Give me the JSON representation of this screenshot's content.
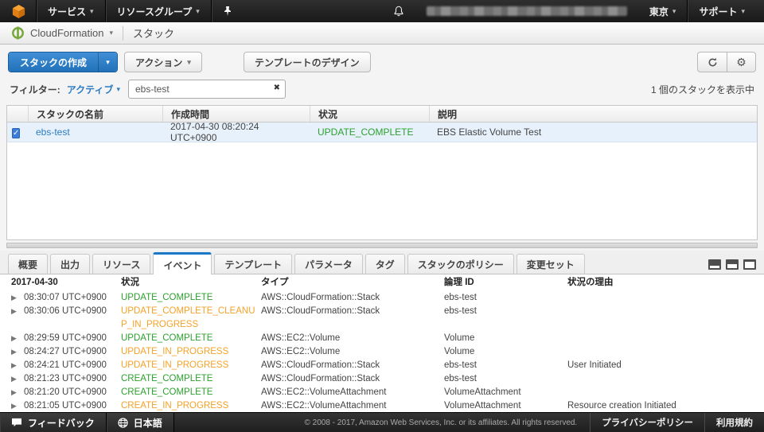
{
  "topnav": {
    "services_label": "サービス",
    "resource_groups_label": "リソースグループ",
    "region_label": "東京",
    "support_label": "サポート"
  },
  "servicebar": {
    "service_name": "CloudFormation",
    "breadcrumb": "スタック"
  },
  "toolbar": {
    "create_stack_label": "スタックの作成",
    "actions_label": "アクション",
    "design_template_label": "テンプレートのデザイン"
  },
  "filter": {
    "label": "フィルター:",
    "status_filter": "アクティブ",
    "search_value": "ebs-test",
    "count_text": "1 個のスタックを表示中"
  },
  "stacks_table": {
    "headers": [
      "スタックの名前",
      "作成時間",
      "状況",
      "説明"
    ],
    "rows": [
      {
        "checked": true,
        "name": "ebs-test",
        "created": "2017-04-30 08:20:24 UTC+0900",
        "status": "UPDATE_COMPLETE",
        "status_color": "green",
        "description": "EBS Elastic Volume Test"
      }
    ]
  },
  "tabs": [
    "概要",
    "出力",
    "リソース",
    "イベント",
    "テンプレート",
    "パラメータ",
    "タグ",
    "スタックのポリシー",
    "変更セット"
  ],
  "active_tab": "イベント",
  "events_table": {
    "date_header": "2017-04-30",
    "headers": [
      "状況",
      "タイプ",
      "論理 ID",
      "状況の理由"
    ],
    "rows": [
      {
        "time": "08:30:07 UTC+0900",
        "status": "UPDATE_COMPLETE",
        "status_color": "green",
        "type": "AWS::CloudFormation::Stack",
        "logical_id": "ebs-test",
        "reason": ""
      },
      {
        "time": "08:30:06 UTC+0900",
        "status": "UPDATE_COMPLETE_CLEANUP_IN_PROGRESS",
        "status_color": "orange",
        "type": "AWS::CloudFormation::Stack",
        "logical_id": "ebs-test",
        "reason": ""
      },
      {
        "time": "08:29:59 UTC+0900",
        "status": "UPDATE_COMPLETE",
        "status_color": "green",
        "type": "AWS::EC2::Volume",
        "logical_id": "Volume",
        "reason": ""
      },
      {
        "time": "08:24:27 UTC+0900",
        "status": "UPDATE_IN_PROGRESS",
        "status_color": "orange",
        "type": "AWS::EC2::Volume",
        "logical_id": "Volume",
        "reason": ""
      },
      {
        "time": "08:24:21 UTC+0900",
        "status": "UPDATE_IN_PROGRESS",
        "status_color": "orange",
        "type": "AWS::CloudFormation::Stack",
        "logical_id": "ebs-test",
        "reason": "User Initiated"
      },
      {
        "time": "08:21:23 UTC+0900",
        "status": "CREATE_COMPLETE",
        "status_color": "green",
        "type": "AWS::CloudFormation::Stack",
        "logical_id": "ebs-test",
        "reason": ""
      },
      {
        "time": "08:21:20 UTC+0900",
        "status": "CREATE_COMPLETE",
        "status_color": "green",
        "type": "AWS::EC2::VolumeAttachment",
        "logical_id": "VolumeAttachment",
        "reason": ""
      },
      {
        "time": "08:21:05 UTC+0900",
        "status": "CREATE_IN_PROGRESS",
        "status_color": "orange",
        "type": "AWS::EC2::VolumeAttachment",
        "logical_id": "VolumeAttachment",
        "reason": "Resource creation Initiated"
      }
    ]
  },
  "footer": {
    "feedback_label": "フィードバック",
    "language_label": "日本語",
    "copyright": "© 2008 - 2017, Amazon Web Services, Inc. or its affiliates. All rights reserved.",
    "privacy_label": "プライバシーポリシー",
    "terms_label": "利用規約"
  },
  "icons": {
    "caret": "▾",
    "expand_arrow": "▶",
    "clear": "✖",
    "gear": "⚙",
    "check": "✓"
  },
  "colors": {
    "status_green": "#2ca12e",
    "status_orange": "#f5a227",
    "link_blue": "#2d7bc0",
    "primary_button_blue": "#2272ba",
    "active_tab_blue": "#1a78c9",
    "aws_orange": "#f8a233"
  }
}
